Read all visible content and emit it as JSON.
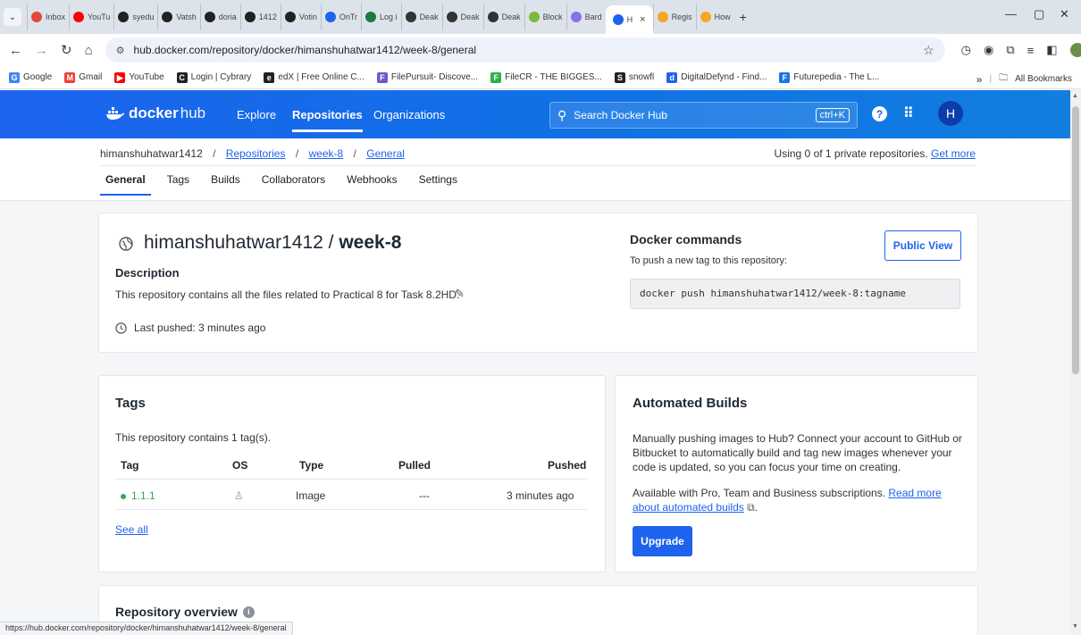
{
  "browser": {
    "tabs": [
      {
        "label": "Inbox",
        "color": "#e5483b"
      },
      {
        "label": "YouTu",
        "color": "#ff0000"
      },
      {
        "label": "syedu",
        "color": "#222222"
      },
      {
        "label": "Vatsh",
        "color": "#222222"
      },
      {
        "label": "doria",
        "color": "#222222"
      },
      {
        "label": "1412",
        "color": "#222222"
      },
      {
        "label": "Votin",
        "color": "#222222"
      },
      {
        "label": "OnTr",
        "color": "#1d63ed"
      },
      {
        "label": "Log i",
        "color": "#1b7a3e"
      },
      {
        "label": "Deak",
        "color": "#333333"
      },
      {
        "label": "Deak",
        "color": "#333333"
      },
      {
        "label": "Deak",
        "color": "#333333"
      },
      {
        "label": "Block",
        "color": "#7db83a"
      },
      {
        "label": "Bard",
        "color": "#8c6ff0"
      }
    ],
    "active_tab": {
      "label": "H",
      "close": "×"
    },
    "tabs_after": [
      {
        "label": "Regis",
        "color": "#f6a623"
      },
      {
        "label": "How",
        "color": "#f6a623"
      }
    ],
    "new_tab": "+",
    "url": "hub.docker.com/repository/docker/himanshuhatwar1412/week-8/general",
    "bookmarks": [
      {
        "label": "Google",
        "icon": "G",
        "color": "#4285f4"
      },
      {
        "label": "Gmail",
        "icon": "M",
        "color": "#ea4335"
      },
      {
        "label": "YouTube",
        "icon": "▶",
        "color": "#ff0000"
      },
      {
        "label": "Login | Cybrary",
        "icon": "C",
        "color": "#222222"
      },
      {
        "label": "edX | Free Online C...",
        "icon": "e",
        "color": "#222222"
      },
      {
        "label": "FilePursuit- Discove...",
        "icon": "F",
        "color": "#6a5acd"
      },
      {
        "label": "FileCR - THE BIGGES...",
        "icon": "F",
        "color": "#2bb24c"
      },
      {
        "label": "snowfl",
        "icon": "S",
        "color": "#222222"
      },
      {
        "label": "DigitalDefynd - Find...",
        "icon": "d",
        "color": "#1d63ed"
      },
      {
        "label": "Futurepedia - The L...",
        "icon": "F",
        "color": "#1a73e8"
      }
    ],
    "more_bookmarks": "»",
    "all_bookmarks": "All Bookmarks",
    "status_url": "https://hub.docker.com/repository/docker/himanshuhatwar1412/week-8/general"
  },
  "header": {
    "logo_bold": "docker",
    "logo_light": "hub",
    "nav": [
      "Explore",
      "Repositories",
      "Organizations"
    ],
    "search_placeholder": "Search Docker Hub",
    "search_shortcut": "ctrl+K",
    "avatar_letter": "H"
  },
  "breadcrumb": {
    "user": "himanshuhatwar1412",
    "items": [
      "Repositories",
      "week-8",
      "General"
    ]
  },
  "private_info": {
    "text": "Using 0 of 1 private repositories.",
    "link": "Get more"
  },
  "tabs": [
    "General",
    "Tags",
    "Builds",
    "Collaborators",
    "Webhooks",
    "Settings"
  ],
  "repo": {
    "owner": "himanshuhatwar1412",
    "slash": " / ",
    "name": "week-8",
    "description_label": "Description",
    "description": "This repository contains all the files related to Practical 8 for Task 8.2HD.",
    "last_pushed": "Last pushed: 3 minutes ago"
  },
  "commands": {
    "title": "Docker commands",
    "subtitle": "To push a new tag to this repository:",
    "public_view": "Public View",
    "command": "docker push himanshuhatwar1412/week-8:tagname"
  },
  "tags_card": {
    "title": "Tags",
    "count_text": "This repository contains 1 tag(s).",
    "columns": [
      "Tag",
      "OS",
      "Type",
      "Pulled",
      "Pushed"
    ],
    "rows": [
      {
        "tag": "1.1.1",
        "type": "Image",
        "pulled": "---",
        "pushed": "3 minutes ago"
      }
    ],
    "see_all": "See all"
  },
  "builds_card": {
    "title": "Automated Builds",
    "text": "Manually pushing images to Hub? Connect your account to GitHub or Bitbucket to automatically build and tag new images whenever your code is updated, so you can focus your time on creating.",
    "text2": "Available with Pro, Team and Business subscriptions.",
    "link": "Read more about automated builds",
    "link_icon": "⧉",
    "upgrade": "Upgrade"
  },
  "overview": {
    "title": "Repository overview",
    "info_icon": "i"
  },
  "colors": {
    "brand_blue": "#1d63ed",
    "tag_green": "#34a853"
  }
}
